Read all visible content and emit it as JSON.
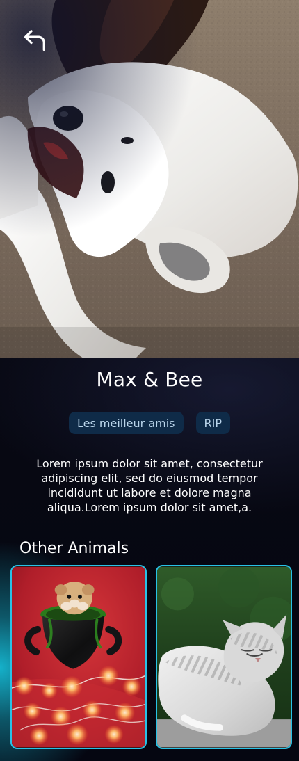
{
  "header": {
    "back_icon": "back-arrow-icon"
  },
  "profile": {
    "title": "Max & Bee",
    "tags": [
      "Les meilleur amis",
      "RIP"
    ],
    "description": "Lorem ipsum dolor sit amet, consectetur adipiscing elit, sed do eiusmod tempor incididunt ut labore et dolore magna aliqua.Lorem ipsum dolor sit amet,a."
  },
  "other_animals": {
    "heading": "Other Animals",
    "cards": [
      {
        "image_name": "hamster-in-cauldron-image"
      },
      {
        "image_name": "tabby-cat-image"
      }
    ]
  },
  "colors": {
    "background": "#070812",
    "tag_background": "#0f2b48",
    "tag_text": "#b9d4ea",
    "card_border": "#28c2e6",
    "glow": "#16bad4"
  }
}
